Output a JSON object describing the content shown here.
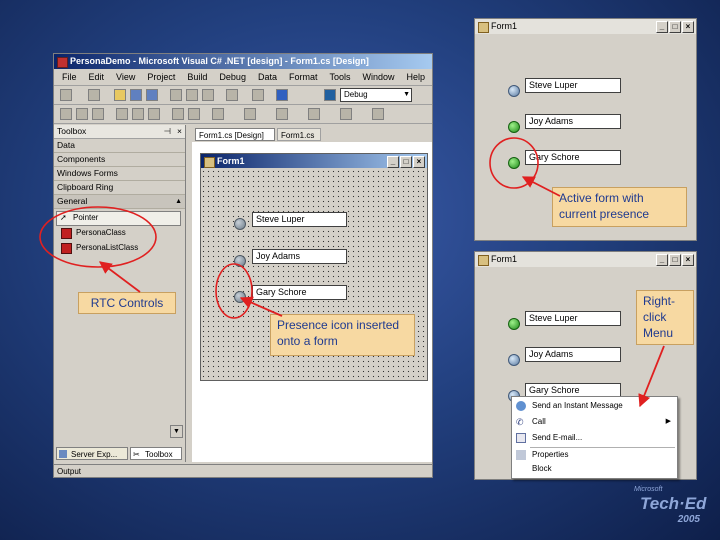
{
  "ide": {
    "title": "PersonaDemo - Microsoft Visual C# .NET [design] - Form1.cs [Design]",
    "menu": [
      "File",
      "Edit",
      "View",
      "Project",
      "Build",
      "Debug",
      "Data",
      "Format",
      "Tools",
      "Window",
      "Help"
    ],
    "config_value": "Debug",
    "toolbox": {
      "title": "Toolbox",
      "tabs": [
        "Data",
        "Components",
        "Windows Forms",
        "Clipboard Ring"
      ],
      "general_tab": "General",
      "items": [
        "Pointer",
        "PersonaClass",
        "PersonaListClass"
      ],
      "bottom_tabs": [
        "Server Exp...",
        "Toolbox"
      ]
    },
    "doc_tabs": [
      "Form1.cs [Design]",
      "Form1.cs"
    ],
    "output_label": "Output",
    "form": {
      "title": "Form1",
      "fields": [
        "Steve Luper",
        "Joy Adams",
        "Gary Schore"
      ]
    }
  },
  "form_active": {
    "title": "Form1",
    "fields": [
      "Steve Luper",
      "Joy Adams",
      "Gary Schore"
    ]
  },
  "form_menu": {
    "title": "Form1",
    "fields": [
      "Steve Luper",
      "Joy Adams",
      "Gary Schore"
    ],
    "context_menu": [
      "Send an Instant Message",
      "Call",
      "Send E-mail...",
      "Properties",
      "Block"
    ]
  },
  "callouts": {
    "rtc": "RTC Controls",
    "presence": "Presence icon inserted onto a form",
    "active": "Active form with current presence",
    "rightclick": "Right-click Menu"
  },
  "logo": {
    "brand": "Microsoft",
    "event": "Tech·Ed",
    "year": "2005"
  },
  "colors": {
    "arrow": "#e02020",
    "callout_bg": "#f7d9a2",
    "callout_text": "#1f3a90",
    "title_bar": "#0a246a"
  }
}
